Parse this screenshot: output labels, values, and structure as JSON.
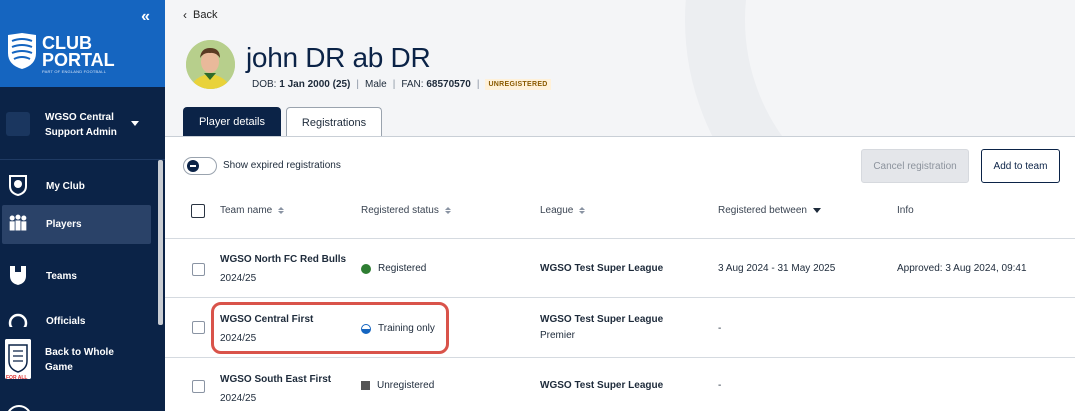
{
  "sidebar": {
    "collapse_icon": "double-chevron-left-icon",
    "brand_line1": "CLUB",
    "brand_line2": "PORTAL",
    "brand_sub": "PART OF ENGLAND FOOTBALL",
    "org_name": "WGSO Central Support Admin",
    "nav": [
      {
        "label": "My Club",
        "icon": "club-crest-icon"
      },
      {
        "label": "Players",
        "icon": "players-icon"
      },
      {
        "label": "Teams",
        "icon": "shirt-icon"
      },
      {
        "label": "Officials",
        "icon": "whistle-icon"
      }
    ],
    "back_label": "Back to Whole Game",
    "fa_text": "FOR ALL"
  },
  "header": {
    "back_label": "Back",
    "player_name": "john DR ab DR",
    "dob_label": "DOB:",
    "dob_value": "1 Jan 2000 (25)",
    "gender": "Male",
    "fan_label": "FAN:",
    "fan_value": "68570570",
    "status_badge": "UNREGISTERED"
  },
  "tabs": [
    "Player details",
    "Registrations"
  ],
  "toolbar": {
    "toggle_label": "Show expired registrations",
    "cancel_label": "Cancel registration",
    "add_label": "Add to team"
  },
  "table": {
    "columns": [
      "Team name",
      "Registered status",
      "League",
      "Registered between",
      "Info"
    ],
    "rows": [
      {
        "team": "WGSO North FC Red Bulls",
        "season": "2024/25",
        "status": "Registered",
        "league": "WGSO Test Super League",
        "division": "",
        "between": "3 Aug 2024 - 31 May 2025",
        "info": "Approved: 3 Aug 2024, 09:41"
      },
      {
        "team": "WGSO Central First",
        "season": "2024/25",
        "status": "Training only",
        "league": "WGSO Test Super League",
        "division": "Premier",
        "between": "-",
        "info": ""
      },
      {
        "team": "WGSO South East First",
        "season": "2024/25",
        "status": "Unregistered",
        "league": "WGSO Test Super League",
        "division": "",
        "between": "-",
        "info": ""
      }
    ]
  },
  "colors": {
    "sidebar": "#0b2347",
    "brand": "#1565c0",
    "highlight": "#d9534a",
    "registered": "#2e7d32"
  }
}
